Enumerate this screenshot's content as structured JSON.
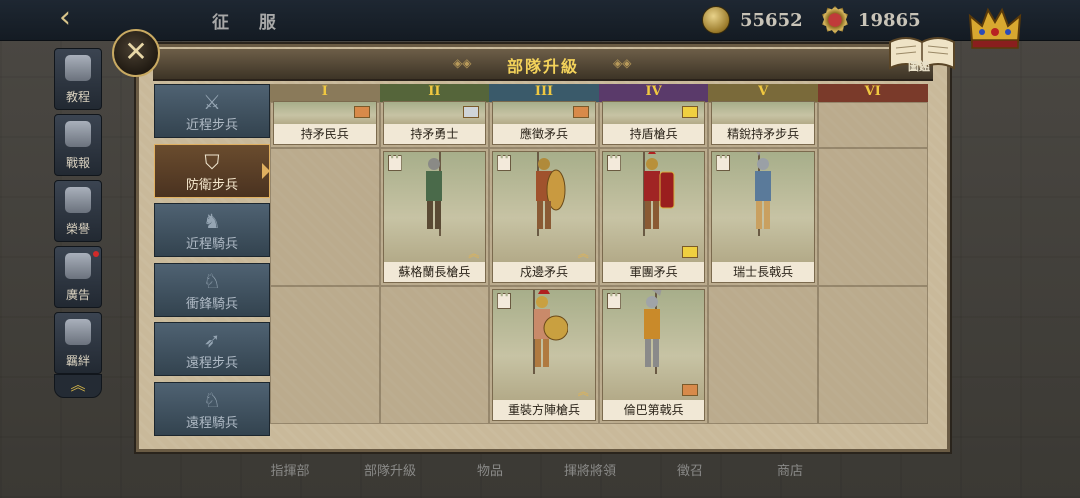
{
  "topbar": {
    "back_icon": "back-arrow-icon",
    "title": "征 服",
    "gold": "55652",
    "medals": "19865"
  },
  "left_nav": [
    {
      "label": "教程",
      "icon": "book-icon"
    },
    {
      "label": "戰報",
      "icon": "scroll-icon"
    },
    {
      "label": "榮譽",
      "icon": "trophy-icon"
    },
    {
      "label": "廣告",
      "icon": "film-icon",
      "notification": true
    },
    {
      "label": "羈絆",
      "icon": "handshake-icon"
    }
  ],
  "panel": {
    "title": "部隊升級",
    "codex_label": "圖鑑"
  },
  "categories": [
    {
      "label": "近程步兵",
      "icon": "crossed-swords-icon",
      "active": false
    },
    {
      "label": "防衛步兵",
      "icon": "shield-icon",
      "active": true
    },
    {
      "label": "近程騎兵",
      "icon": "horse-icon",
      "active": false
    },
    {
      "label": "衝鋒騎兵",
      "icon": "charging-horse-icon",
      "active": false
    },
    {
      "label": "遠程步兵",
      "icon": "bow-icon",
      "active": false
    },
    {
      "label": "遠程騎兵",
      "icon": "horse-archer-icon",
      "active": false
    }
  ],
  "tiers": [
    "I",
    "II",
    "III",
    "IV",
    "V",
    "VI"
  ],
  "tier_colors": [
    "#8a7a5a",
    "#55653a",
    "#3a5a6a",
    "#5a3a6a",
    "#7a6a3a",
    "#7a3a2a"
  ],
  "units": {
    "row0": [
      "持矛民兵",
      "持矛勇士",
      "應徵矛兵",
      "持盾槍兵",
      "精銳持矛步兵"
    ],
    "row1": [
      "蘇格蘭長槍兵",
      "戍邊矛兵",
      "軍團矛兵",
      "瑞士長戟兵"
    ],
    "row2": [
      "重裝方陣槍兵",
      "倫巴第戟兵"
    ]
  },
  "bottom_tabs": [
    "指揮部",
    "部隊升級",
    "物品",
    "揮將將領",
    "徵召",
    "商店"
  ]
}
